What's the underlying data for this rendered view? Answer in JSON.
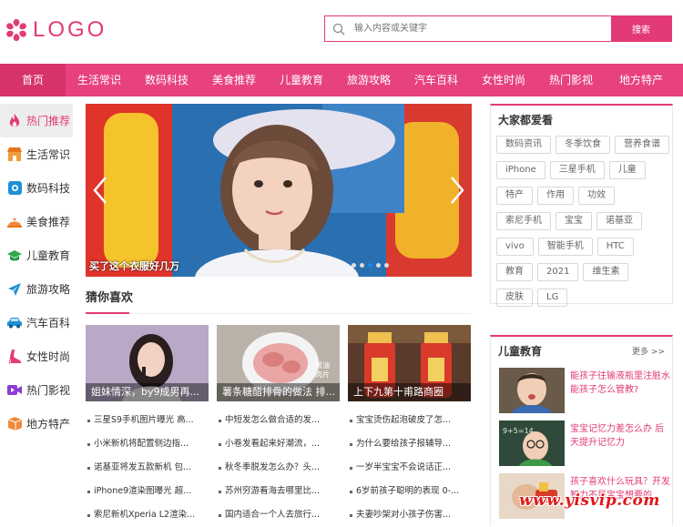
{
  "header": {
    "logo_text": "LOGO",
    "search_placeholder": "输入内容或关键字",
    "search_button": "搜索"
  },
  "nav": {
    "items": [
      "首页",
      "生活常识",
      "数码科技",
      "美食推荐",
      "儿童教育",
      "旅游攻略",
      "汽车百科",
      "女性时尚",
      "热门影视",
      "地方特产"
    ]
  },
  "sidebar": {
    "items": [
      {
        "label": "热门推荐",
        "icon": "flame-icon",
        "color": "#e23a78"
      },
      {
        "label": "生活常识",
        "icon": "shop-icon",
        "color": "#f39a3c"
      },
      {
        "label": "数码科技",
        "icon": "camera-icon",
        "color": "#1e90d6"
      },
      {
        "label": "美食推荐",
        "icon": "cloche-icon",
        "color": "#f08a3c"
      },
      {
        "label": "儿童教育",
        "icon": "graduation-cap-icon",
        "color": "#2eaa4a"
      },
      {
        "label": "旅游攻略",
        "icon": "airplane-icon",
        "color": "#1e90d6"
      },
      {
        "label": "汽车百科",
        "icon": "car-icon",
        "color": "#1e90d6"
      },
      {
        "label": "女性时尚",
        "icon": "high-heel-icon",
        "color": "#e23a78"
      },
      {
        "label": "热门影视",
        "icon": "video-icon",
        "color": "#8a3cd6"
      },
      {
        "label": "地方特产",
        "icon": "gift-box-icon",
        "color": "#f08a3c"
      }
    ]
  },
  "banner": {
    "caption": "买了这个衣服好几万"
  },
  "guess": {
    "title": "猜你喜欢",
    "thumbs": [
      {
        "caption": "姐妹情深，by9成男再..."
      },
      {
        "caption": "薯条糖醋排骨的做法 排..."
      },
      {
        "caption": "上下九第十甫路商圈"
      }
    ],
    "columns": [
      [
        "三星S9手机图片曝光 高...",
        "小米新机将配置侧边指...",
        "诺基亚将发五款新机 包...",
        "iPhone9渲染图曝光 超...",
        "索尼新机Xperia L2渲染..."
      ],
      [
        "中短发怎么做合适的发...",
        "小卷发看起来好潮流，...",
        "秋冬季脱发怎么办？头...",
        "苏州穷游看海去哪里比...",
        "国内适合一个人去旅行..."
      ],
      [
        "宝宝烫伤起泡破皮了怎...",
        "为什么要给孩子报辅导...",
        "一岁半宝宝不会说话正...",
        "6岁前孩子聪明的表现 0-...",
        "夫妻吵架对小孩子伤害..."
      ]
    ]
  },
  "popular": {
    "title": "大家都爱看",
    "tags": [
      "数码资讯",
      "冬季饮食",
      "营养食谱",
      "iPhone",
      "三星手机",
      "儿童",
      "特产",
      "作用",
      "功效",
      "索尼手机",
      "宝宝",
      "诺基亚",
      "vivo",
      "智能手机",
      "HTC",
      "教育",
      "2021",
      "维生素",
      "皮肤",
      "LG"
    ]
  },
  "education": {
    "title": "儿童教育",
    "more": "更多 >>",
    "items": [
      {
        "text": "能孩子往输液瓶里注脏水能孩子怎么管教?"
      },
      {
        "text": "宝宝记忆力差怎么办 后天提升记忆力"
      },
      {
        "text": "孩子喜欢什么玩具？开发智力不是宝宝想要的"
      }
    ]
  },
  "watermark": "www.yisvip.com",
  "colors": {
    "accent": "#e23a78",
    "nav": "#e7417e"
  }
}
